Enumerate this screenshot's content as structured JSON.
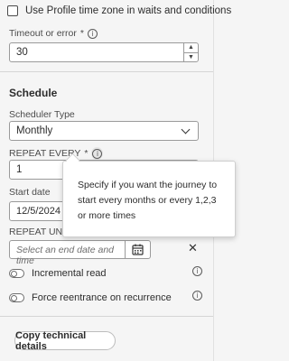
{
  "checkbox": {
    "label": "Use Profile time zone in waits and conditions",
    "checked": false
  },
  "timeout": {
    "label": "Timeout or error",
    "required_mark": "*",
    "value": "30"
  },
  "schedule": {
    "heading": "Schedule",
    "scheduler_type_label": "Scheduler Type",
    "scheduler_type_value": "Monthly",
    "repeat_every_label": "REPEAT EVERY",
    "repeat_every_required": "*",
    "repeat_every_value": "1",
    "start_date_label": "Start date",
    "start_date_value": "12/5/2024 04:",
    "repeat_until_label": "REPEAT UNTIL",
    "repeat_until_placeholder": "Select an end date and time",
    "close_glyph": "✕"
  },
  "toggles": [
    {
      "label": "Incremental read",
      "on": false
    },
    {
      "label": "Force reentrance on recurrence",
      "on": false
    }
  ],
  "copy_button": "Copy technical details",
  "tooltip": "Specify if you want the journey to start every months or every 1,2,3 or more times",
  "icons": {
    "info": "info-icon",
    "calendar": "calendar-icon",
    "chevron": "chevron-down-icon",
    "close": "close-icon"
  }
}
